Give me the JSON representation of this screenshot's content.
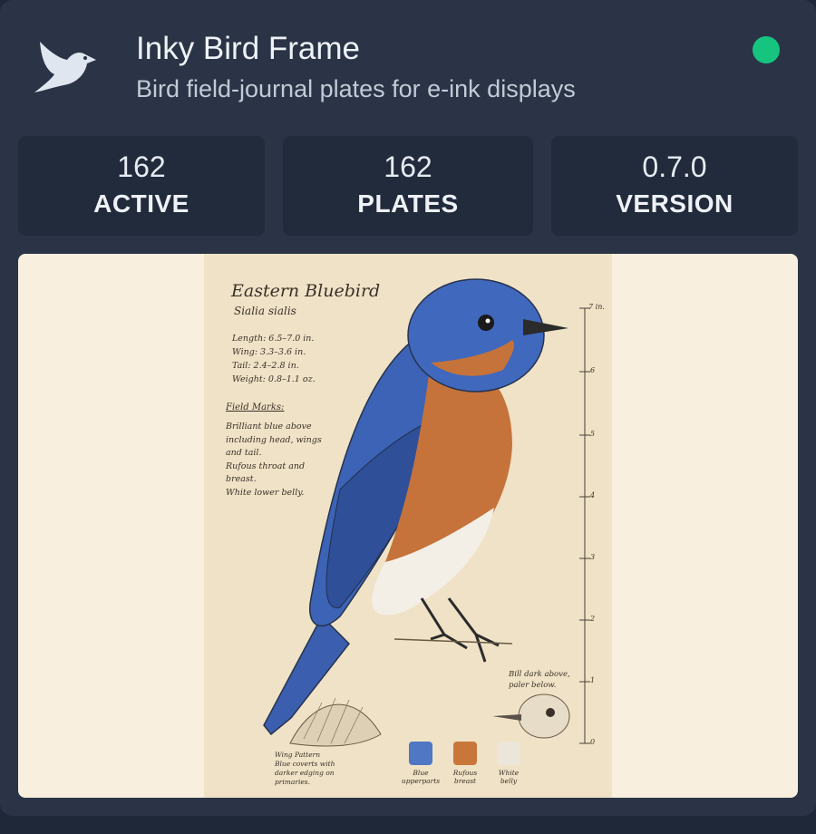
{
  "header": {
    "title": "Inky Bird Frame",
    "subtitle": "Bird field-journal plates for e-ink displays",
    "status_color": "#16c47f",
    "logo_icon": "bird-icon"
  },
  "stats": [
    {
      "value": "162",
      "label": "ACTIVE"
    },
    {
      "value": "162",
      "label": "PLATES"
    },
    {
      "value": "0.7.0",
      "label": "VERSION"
    }
  ],
  "plate": {
    "common_name": "Eastern Bluebird",
    "scientific_name": "Sialia sialis",
    "measurements": "Length: 6.5–7.0 in.\nWing: 3.3–3.6 in.\nTail: 2.4–2.8 in.\nWeight: 0.8–1.1 oz.",
    "field_marks_heading": "Field Marks:",
    "field_marks": "Brilliant blue above\nincluding head, wings\nand tail.\nRufous throat and\nbreast.\nWhite lower belly.",
    "bill_note": "Bill dark above,\npaler below.",
    "wing_note": "Wing Pattern\nBlue coverts with\ndarker edging on\nprimaries.",
    "scale_labels": [
      "7 in.",
      "6",
      "5",
      "4",
      "3",
      "2",
      "1",
      "0"
    ],
    "swatches": [
      {
        "label": "Blue\nupperparts",
        "color": "#4f77c4"
      },
      {
        "label": "Rufous\nbreast",
        "color": "#c8763a"
      },
      {
        "label": "White\nbelly",
        "color": "#ece6da"
      }
    ]
  }
}
